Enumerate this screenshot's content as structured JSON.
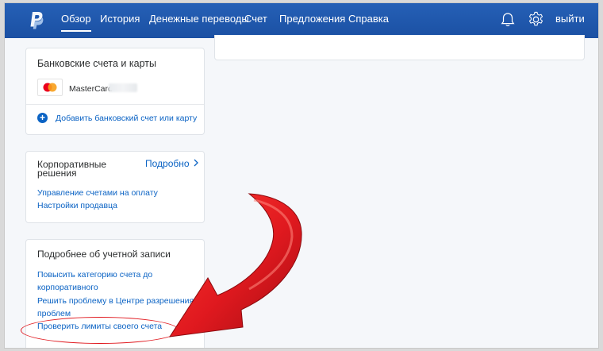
{
  "nav": {
    "items": [
      "Обзор",
      "История",
      "Денежные переводы",
      "Счет",
      "Предложения",
      "Справка"
    ],
    "active": "Обзор",
    "logout": "выйти"
  },
  "bank_card": {
    "title": "Банковские счета и карты",
    "card_name": "MasterCard",
    "add_link": "Добавить банковский счет или карту"
  },
  "corp_card": {
    "title_line1": "Корпоративные",
    "title_line2": "решения",
    "more": "Подробно",
    "links": [
      "Управление счетами на оплату",
      "Настройки продавца"
    ]
  },
  "account_card": {
    "title": "Подробнее об учетной записи",
    "link1_line1": "Повысить категорию счета до",
    "link1_line2": "корпоративного",
    "link2_line1": "Решить проблему в Центре разрешения",
    "link2_line2": "проблем",
    "link3": "Проверить лимиты своего счета"
  },
  "colors": {
    "nav_bg": "#1f57ad",
    "link": "#0b63c4",
    "highlight": "#e0191f"
  },
  "icons": [
    "paypal-logo",
    "bell-icon",
    "gear-icon",
    "mastercard-icon",
    "plus-circle-icon",
    "chevron-right-icon",
    "red-arrow"
  ]
}
